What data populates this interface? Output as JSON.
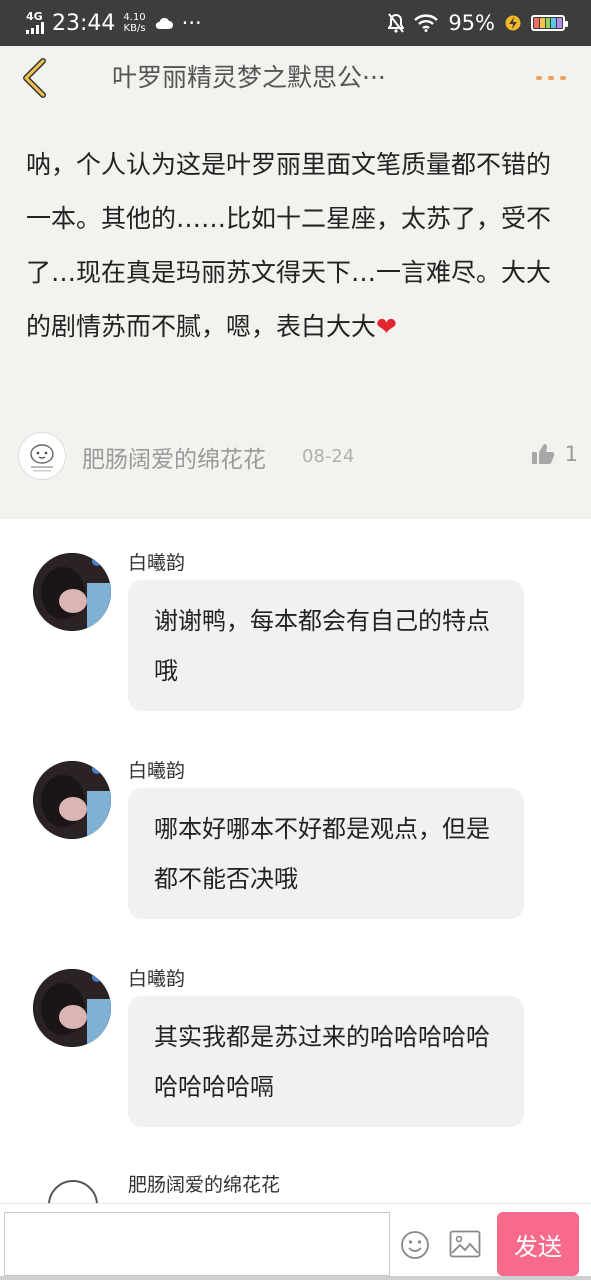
{
  "status_bar": {
    "network": "4G",
    "time": "23:44",
    "speed_value": "4.10",
    "speed_unit": "KB/s",
    "more": "···",
    "battery": "95%"
  },
  "header": {
    "title": "叶罗丽精灵梦之默思公···"
  },
  "original_comment": {
    "text_main": "呐，个人认为这是叶罗丽里面文笔质量都不错的一本。其他的……比如十二星座，太苏了，受不了…现在真是玛丽苏文得天下…一言难尽。大大的剧情苏而不腻，嗯，表白大大",
    "heart": "❤",
    "author": "肥肠阔爱的绵花花",
    "date": "08-24",
    "likes": "1"
  },
  "replies": [
    {
      "name": "白曦韵",
      "text": "谢谢鸭，每本都会有自己的特点哦"
    },
    {
      "name": "白曦韵",
      "text": "哪本好哪本不好都是观点，但是都不能否决哦"
    },
    {
      "name": "白曦韵",
      "text": "其实我都是苏过来的哈哈哈哈哈哈哈哈哈嗝"
    },
    {
      "name": "肥肠阔爱的绵花花"
    }
  ],
  "input_bar": {
    "placeholder": "",
    "send_label": "发送"
  },
  "colors": {
    "accent_send": "#f76a8c",
    "back_arrow": "#f0c34a",
    "more_dots": "#f0a060",
    "header_bg": "#f2f2ef"
  }
}
